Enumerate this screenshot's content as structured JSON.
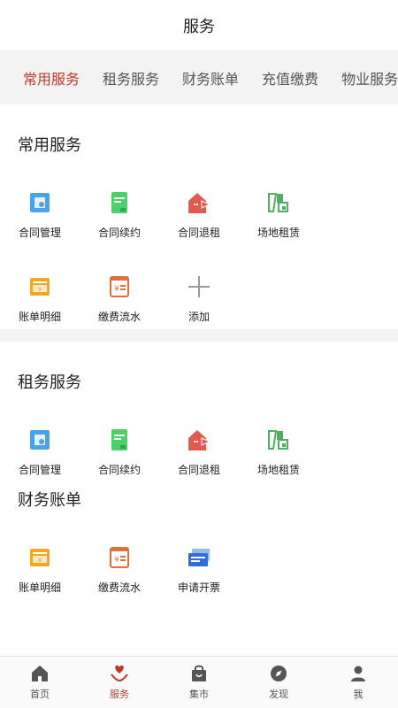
{
  "header": {
    "title": "服务"
  },
  "tabs": [
    {
      "label": "常用服务",
      "active": true
    },
    {
      "label": "租务服务",
      "active": false
    },
    {
      "label": "财务账单",
      "active": false
    },
    {
      "label": "充值缴费",
      "active": false
    },
    {
      "label": "物业服务",
      "active": false
    }
  ],
  "common": {
    "title": "常用服务",
    "items": [
      {
        "label": "合同管理",
        "icon": "contract-manage-icon"
      },
      {
        "label": "合同续约",
        "icon": "contract-renew-icon"
      },
      {
        "label": "合同退租",
        "icon": "contract-terminate-icon"
      },
      {
        "label": "场地租赁",
        "icon": "venue-rental-icon"
      },
      {
        "label": "账单明细",
        "icon": "bill-detail-icon"
      },
      {
        "label": "缴费流水",
        "icon": "payment-record-icon"
      },
      {
        "label": "添加",
        "icon": "plus-icon"
      }
    ]
  },
  "rental": {
    "title": "租务服务",
    "items": [
      {
        "label": "合同管理",
        "icon": "contract-manage-icon"
      },
      {
        "label": "合同续约",
        "icon": "contract-renew-icon"
      },
      {
        "label": "合同退租",
        "icon": "contract-terminate-icon"
      },
      {
        "label": "场地租赁",
        "icon": "venue-rental-icon"
      }
    ]
  },
  "finance": {
    "title": "财务账单",
    "items": [
      {
        "label": "账单明细",
        "icon": "bill-detail-icon"
      },
      {
        "label": "缴费流水",
        "icon": "payment-record-icon"
      },
      {
        "label": "申请开票",
        "icon": "invoice-icon"
      }
    ]
  },
  "nav": [
    {
      "label": "首页",
      "icon": "home-icon",
      "active": false
    },
    {
      "label": "服务",
      "icon": "heart-hands-icon",
      "active": true
    },
    {
      "label": "集市",
      "icon": "shopping-bag-icon",
      "active": false
    },
    {
      "label": "发现",
      "icon": "compass-icon",
      "active": false
    },
    {
      "label": "我",
      "icon": "user-icon",
      "active": false
    }
  ],
  "colors": {
    "accent": "#c0392b",
    "tabs_bg": "#f3f3f3"
  }
}
